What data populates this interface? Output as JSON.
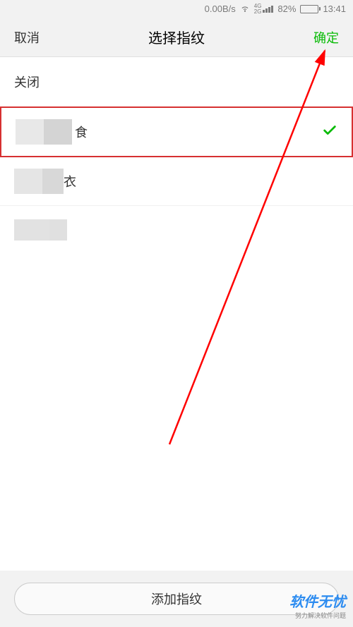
{
  "status_bar": {
    "data_rate": "0.00B/s",
    "network": "4G",
    "network2": "2G",
    "battery_percent": "82%",
    "time": "13:41",
    "battery_fill": 82
  },
  "nav": {
    "cancel": "取消",
    "title": "选择指纹",
    "confirm": "确定"
  },
  "section": {
    "close_label": "关闭"
  },
  "list": {
    "item1": {
      "suffix": "食",
      "selected": true
    },
    "item2": {
      "suffix": "衣",
      "selected": false
    },
    "item3": {
      "suffix": "",
      "selected": false
    }
  },
  "bottom": {
    "add_label": "添加指纹"
  },
  "watermark": {
    "title": "软件无忧",
    "subtitle": "努力解决软件问题"
  },
  "colors": {
    "accent": "#09bb07",
    "highlight_border": "#d63031",
    "arrow": "#ff0000"
  }
}
